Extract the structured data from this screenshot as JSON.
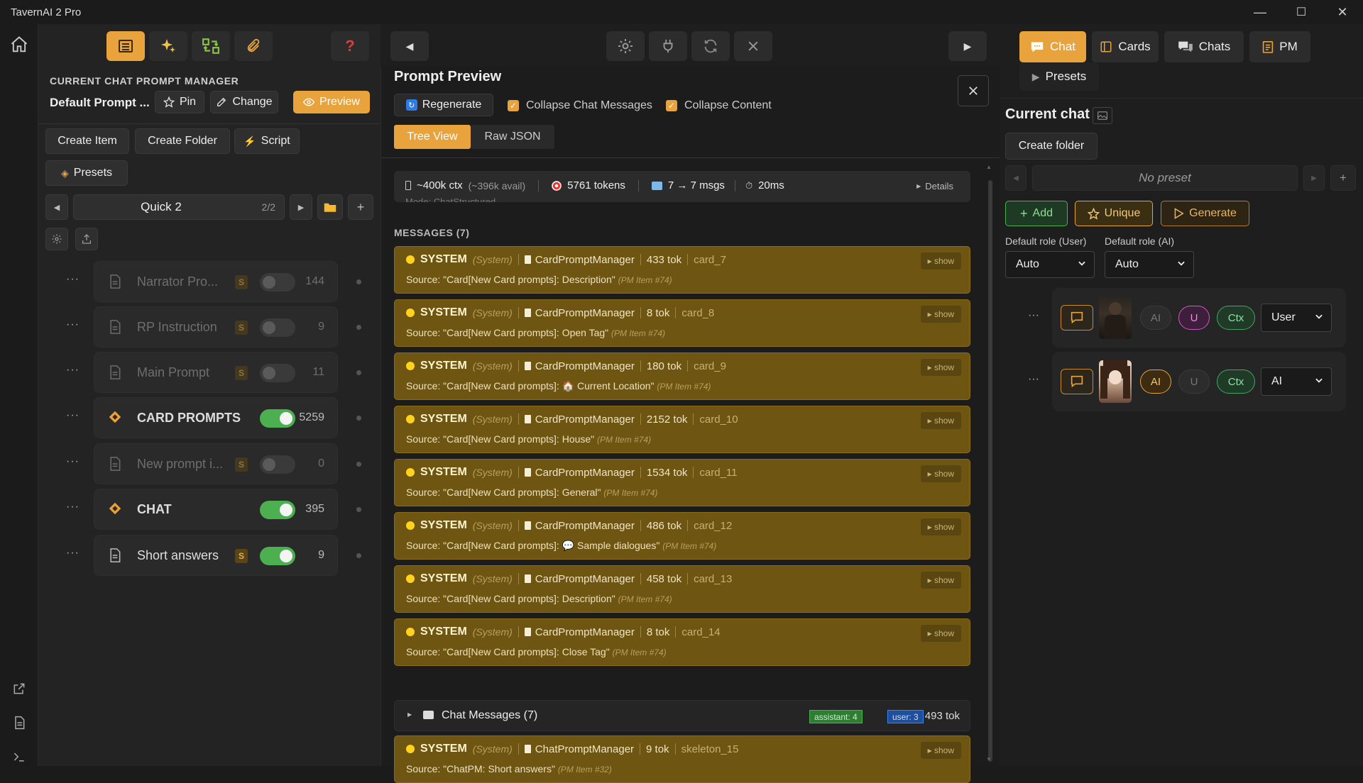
{
  "app": {
    "title": "TavernAI 2 Pro"
  },
  "window_controls": {
    "minimize": "—",
    "maximize": "☐",
    "close": "✕"
  },
  "left": {
    "section_label": "CURRENT CHAT PROMPT MANAGER",
    "preset_name": "Default Prompt ...",
    "pin_label": "Pin",
    "change_label": "Change",
    "preview_label": "Preview",
    "create_item": "Create Item",
    "create_folder": "Create Folder",
    "script": "Script",
    "presets": "Presets",
    "quick_name": "Quick 2",
    "quick_page": "2/2",
    "rows": [
      {
        "name": "Narrator Pro...",
        "badge": "S",
        "on": false,
        "count": "144",
        "kind": "doc",
        "disabled": true
      },
      {
        "name": "RP Instruction",
        "badge": "S",
        "on": false,
        "count": "9",
        "kind": "doc",
        "disabled": true
      },
      {
        "name": "Main Prompt",
        "badge": "S",
        "on": false,
        "count": "11",
        "kind": "doc",
        "disabled": true
      },
      {
        "name": "CARD PROMPTS",
        "badge": "",
        "on": true,
        "count": "5259",
        "kind": "folder",
        "disabled": false
      },
      {
        "name": "New prompt i...",
        "badge": "S",
        "on": false,
        "count": "0",
        "kind": "doc",
        "disabled": true
      },
      {
        "name": "CHAT",
        "badge": "",
        "on": true,
        "count": "395",
        "kind": "folder",
        "disabled": false
      },
      {
        "name": "Short answers",
        "badge": "S",
        "on": true,
        "count": "9",
        "kind": "doc",
        "disabled": false
      }
    ]
  },
  "preview": {
    "title": "Prompt Preview",
    "regenerate": "Regenerate",
    "collapse_chat": "Collapse Chat Messages",
    "collapse_content": "Collapse Content",
    "tree_view": "Tree View",
    "raw_json": "Raw JSON",
    "stats": {
      "ctx": "~400k ctx",
      "avail": "(~396k avail)",
      "tokens": "5761 tokens",
      "msgs": "7 → 7 msgs",
      "time": "20ms",
      "details": "Details"
    },
    "mode_text": "Mode: ChatStructured",
    "messages_header": "MESSAGES (7)",
    "cards": [
      {
        "role": "SYSTEM",
        "sub": "(System)",
        "mgr": "CardPromptManager",
        "tok": "433 tok",
        "id": "card_7",
        "source": "Source: \"Card[New Card prompts]: Description\"",
        "pm": "(PM Item #74)",
        "show": "show"
      },
      {
        "role": "SYSTEM",
        "sub": "(System)",
        "mgr": "CardPromptManager",
        "tok": "8 tok",
        "id": "card_8",
        "source": "Source: \"Card[New Card prompts]: Open Tag\"",
        "pm": "(PM Item #74)",
        "show": "show"
      },
      {
        "role": "SYSTEM",
        "sub": "(System)",
        "mgr": "CardPromptManager",
        "tok": "180 tok",
        "id": "card_9",
        "source": "Source: \"Card[New Card prompts]: 🏠 Current Location\"",
        "pm": "(PM Item #74)",
        "show": "show"
      },
      {
        "role": "SYSTEM",
        "sub": "(System)",
        "mgr": "CardPromptManager",
        "tok": "2152 tok",
        "id": "card_10",
        "source": "Source: \"Card[New Card prompts]: House\"",
        "pm": "(PM Item #74)",
        "show": "show"
      },
      {
        "role": "SYSTEM",
        "sub": "(System)",
        "mgr": "CardPromptManager",
        "tok": "1534 tok",
        "id": "card_11",
        "source": "Source: \"Card[New Card prompts]: General\"",
        "pm": "(PM Item #74)",
        "show": "show"
      },
      {
        "role": "SYSTEM",
        "sub": "(System)",
        "mgr": "CardPromptManager",
        "tok": "486 tok",
        "id": "card_12",
        "source": "Source: \"Card[New Card prompts]: 💬 Sample dialogues\"",
        "pm": "(PM Item #74)",
        "show": "show"
      },
      {
        "role": "SYSTEM",
        "sub": "(System)",
        "mgr": "CardPromptManager",
        "tok": "458 tok",
        "id": "card_13",
        "source": "Source: \"Card[New Card prompts]: Description\"",
        "pm": "(PM Item #74)",
        "show": "show"
      },
      {
        "role": "SYSTEM",
        "sub": "(System)",
        "mgr": "CardPromptManager",
        "tok": "8 tok",
        "id": "card_14",
        "source": "Source: \"Card[New Card prompts]: Close Tag\"",
        "pm": "(PM Item #74)",
        "show": "show"
      }
    ],
    "chat_messages": {
      "label": "Chat Messages (7)",
      "assistant": "assistant: 4",
      "user": "user: 3",
      "tok": "493 tok"
    },
    "last_card": {
      "role": "SYSTEM",
      "sub": "(System)",
      "mgr": "ChatPromptManager",
      "tok": "9 tok",
      "id": "skeleton_15",
      "source": "Source: \"ChatPM: Short answers\"",
      "pm": "(PM Item #32)",
      "show": "show"
    }
  },
  "right": {
    "tabs": {
      "chat": "Chat",
      "cards": "Cards",
      "chats": "Chats",
      "pm": "PM",
      "presets": "Presets"
    },
    "current_chat": "Current chat",
    "create_folder": "Create folder",
    "no_preset": "No preset",
    "add": "Add",
    "unique": "Unique",
    "generate": "Generate",
    "default_role_user_label": "Default role (User)",
    "default_role_ai_label": "Default role (AI)",
    "default_role_user": "Auto",
    "default_role_ai": "Auto",
    "participants": [
      {
        "ai": "AI",
        "u": "U",
        "ctx": "Ctx",
        "role": "User"
      },
      {
        "ai": "AI",
        "u": "U",
        "ctx": "Ctx",
        "role": "AI"
      }
    ]
  },
  "colors": {
    "accent": "#e8a33d",
    "card_bg": "#6e5612",
    "toggle_on": "#4caf50"
  }
}
